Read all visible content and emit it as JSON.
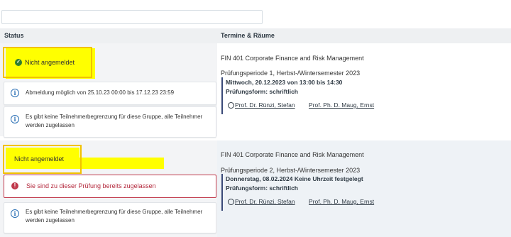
{
  "header": {
    "status_label": "Status",
    "termine_label": "Termine & Räume"
  },
  "rows": [
    {
      "status": "Nicht angemeldet",
      "status_icon": "check-circle-icon",
      "notes": [
        "Abmeldung möglich von 25.10.23 00:00 bis 17.12.23 23:59",
        "Es gibt keine Teilnehmerbegrenzung für diese Gruppe, alle Teilnehmer werden zugelassen"
      ],
      "course": "FIN 401 Corporate Finance and Risk Management",
      "period": "Prüfungsperiode 1, Herbst-/Wintersemester 2023",
      "datetime": "Mittwoch, 20.12.2023 von 13:00 bis 14:30",
      "form": "Prüfungsform: schriftlich",
      "examiners": [
        "Prof. Dr. Rünzi, Stefan",
        "Prof. Ph. D. Maug, Ernst"
      ]
    },
    {
      "status": "Nicht angemeldet",
      "error": "Sie sind zu dieser Prüfung bereits zugelassen",
      "notes": [
        "Es gibt keine Teilnehmerbegrenzung für diese Gruppe, alle Teilnehmer werden zugelassen"
      ],
      "course": "FIN 401 Corporate Finance and Risk Management",
      "period": "Prüfungsperiode 2, Herbst-/Wintersemester 2023",
      "datetime": "Donnerstag, 08.02.2024 Keine Uhrzeit festgelegt",
      "form": "Prüfungsform: schriftlich",
      "examiners": [
        "Prof. Dr. Rünzi, Stefan",
        "Prof. Ph. D. Maug, Ernst"
      ]
    }
  ],
  "colors": {
    "highlight": "#ffff00",
    "highlight_border": "#f2c200",
    "success": "#2f7d32",
    "error": "#c0394b",
    "info": "#2a6fb5"
  }
}
